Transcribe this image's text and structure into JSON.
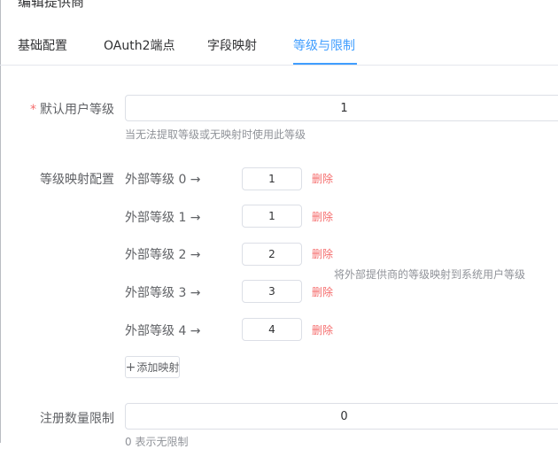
{
  "dialog": {
    "title": "编辑提供商"
  },
  "tabs": [
    {
      "label": "基础配置",
      "active": false
    },
    {
      "label": "OAuth2端点",
      "active": false
    },
    {
      "label": "字段映射",
      "active": false
    },
    {
      "label": "等级与限制",
      "active": true
    }
  ],
  "default_level": {
    "label": "默认用户等级",
    "required_mark": "*",
    "value": "1",
    "help": "当无法提取等级或无映射时使用此等级"
  },
  "level_mapping": {
    "label": "等级映射配置",
    "rows": [
      {
        "label": "外部等级 0 →",
        "value": "1",
        "delete_label": "删除"
      },
      {
        "label": "外部等级 1 →",
        "value": "1",
        "delete_label": "删除"
      },
      {
        "label": "外部等级 2 →",
        "value": "2",
        "delete_label": "删除"
      },
      {
        "label": "外部等级 3 →",
        "value": "3",
        "delete_label": "删除"
      },
      {
        "label": "外部等级 4 →",
        "value": "4",
        "delete_label": "删除"
      }
    ],
    "help": "将外部提供商的等级映射到系统用户等级",
    "add_label": "添加映射"
  },
  "registration_limit": {
    "label": "注册数量限制",
    "value": "0",
    "help": "0 表示无限制"
  },
  "colors": {
    "accent": "#409eff",
    "danger": "#f56c6c",
    "muted": "#909399"
  }
}
